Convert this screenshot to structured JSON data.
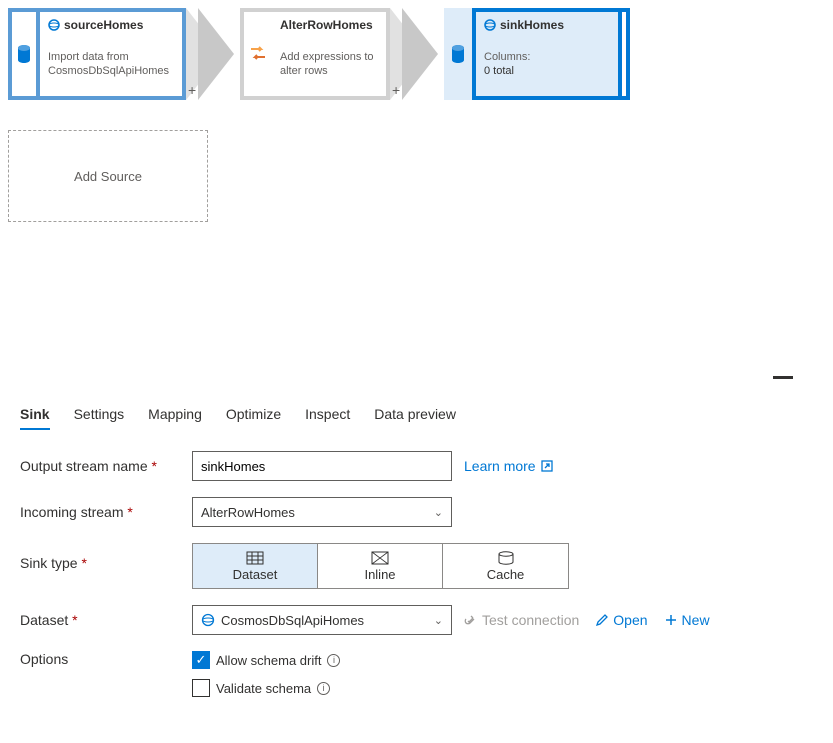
{
  "flow": {
    "source": {
      "title": "sourceHomes",
      "desc": "Import data from CosmosDbSqlApiHomes"
    },
    "transform": {
      "title": "AlterRowHomes",
      "desc": "Add expressions to alter rows"
    },
    "sink": {
      "title": "sinkHomes",
      "columns_label": "Columns:",
      "columns_value": "0 total"
    },
    "add_source_label": "Add Source",
    "plus": "+"
  },
  "tabs": {
    "sink": "Sink",
    "settings": "Settings",
    "mapping": "Mapping",
    "optimize": "Optimize",
    "inspect": "Inspect",
    "preview": "Data preview"
  },
  "form": {
    "output_stream_label": "Output stream name",
    "output_stream_value": "sinkHomes",
    "learn_more": "Learn more",
    "incoming_label": "Incoming stream",
    "incoming_value": "AlterRowHomes",
    "sink_type_label": "Sink type",
    "seg_dataset": "Dataset",
    "seg_inline": "Inline",
    "seg_cache": "Cache",
    "dataset_label": "Dataset",
    "dataset_value": "CosmosDbSqlApiHomes",
    "test_connection": "Test connection",
    "open": "Open",
    "new": "New",
    "options_label": "Options",
    "allow_drift": "Allow schema drift",
    "validate_schema": "Validate schema"
  }
}
